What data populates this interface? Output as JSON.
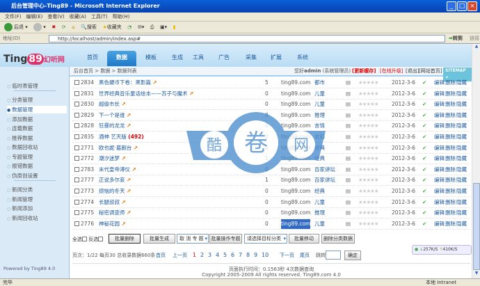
{
  "window": {
    "title": "后台管理中心-Ting89 - Microsoft Internet Explorer"
  },
  "menu": [
    "文件(F)",
    "编辑(E)",
    "查看(V)",
    "收藏(A)",
    "工具(T)",
    "帮助(H)"
  ],
  "toolbar": {
    "back": "后退",
    "search": "搜索",
    "favorites": "收藏夹"
  },
  "address": {
    "label": "地址(D)",
    "url": "http://localhost/admin/index.asp#",
    "go": "转到",
    "links": "链接"
  },
  "logo": {
    "text": "Ting89幻听网.com"
  },
  "tabs": [
    "首页",
    "数据",
    "模板",
    "生成",
    "工具",
    "广告",
    "采集",
    "扩展",
    "系统"
  ],
  "breadcrumb": "后台首页 > 数据 > 数据列表",
  "user": {
    "greeting": "您好",
    "name": "admin",
    "role": "(系统管理员)",
    "refresh": "[更新缓存]",
    "upgrade": "[在线升级]",
    "logout": "[退出]",
    "home": "[网站首页]",
    "sitemap": "SITEMAP +"
  },
  "sidebar": {
    "items": [
      "临时表管理",
      "分类管理",
      "数据管理",
      "添加数据",
      "连载数据",
      "推荐数据",
      "数据回收站",
      "专题管理",
      "报错数据",
      "伪原创设置",
      "新闻分类",
      "新闻管理",
      "新闻添加",
      "新闻回收站"
    ],
    "powered": "Powered by Ting89 4.0"
  },
  "rows": [
    {
      "id": "2834",
      "title": "黑色硬币下卷：黑影篇",
      "count": "5",
      "source": "ting89.com",
      "cat": "都市",
      "date": "2012-3-6"
    },
    {
      "id": "2831",
      "title": "世界经典音乐童话绘本——苏子与魔术",
      "count": "0",
      "source": "ting89.com",
      "cat": "儿童",
      "date": "2012-3-6"
    },
    {
      "id": "2830",
      "title": "超级市长",
      "count": "0",
      "source": "ting89.com",
      "cat": "儿童",
      "date": "2012-3-6"
    },
    {
      "id": "2829",
      "title": "下一个是谁",
      "count": "0",
      "source": "ting89.com",
      "cat": "推理",
      "date": "2012-3-6"
    },
    {
      "id": "2828",
      "title": "狂暴的龙龙",
      "count": "0",
      "source": "ting89.com",
      "cat": "言情",
      "date": "2012-3-6"
    },
    {
      "id": "2835",
      "title": "酒神 艺天版",
      "extra": "(492)",
      "count": "0",
      "source": "ting89.com",
      "cat": "玄幻",
      "date": "2012-3-6"
    },
    {
      "id": "2771",
      "title": "欧也妮·葛朗台",
      "count": "0",
      "source": "ting89.com",
      "cat": "经典",
      "date": "2012-3-6"
    },
    {
      "id": "2772",
      "title": "潮汐迷梦",
      "count": "1",
      "source": "ting89.com",
      "cat": "经典",
      "date": "2012-3-6"
    },
    {
      "id": "2783",
      "title": "末代皇帝溥仪",
      "count": "0",
      "source": "ting89.com",
      "cat": "百家讲坛",
      "date": "2012-3-6"
    },
    {
      "id": "2777",
      "title": "正说多尔衮",
      "count": "1",
      "source": "ting89.com",
      "cat": "百家讲坛",
      "date": "2012-3-6"
    },
    {
      "id": "2773",
      "title": "烦恼的冬天",
      "count": "0",
      "source": "ting89.com",
      "cat": "经典",
      "date": "2012-3-6"
    },
    {
      "id": "2774",
      "title": "长腿叔叔",
      "count": "0",
      "source": "ting89.com",
      "cat": "儿童",
      "date": "2012-3-6"
    },
    {
      "id": "2775",
      "title": "秘密调查师",
      "count": "0",
      "source": "ting89.com",
      "cat": "推理",
      "date": "2012-3-6"
    },
    {
      "id": "2776",
      "title": "神秘花园",
      "count": "0",
      "source": "ting89.com",
      "cat": "儿童",
      "date": "2012-3-6"
    }
  ],
  "row_actions": {
    "edit": "编辑",
    "delete": "删除",
    "hide": "隐藏"
  },
  "batch": {
    "select_all": "全选",
    "invert": "反选",
    "delete": "批量删除",
    "generate": "批量生成",
    "topic_select": "取 消 专 题",
    "topic_op": "批量操作专题",
    "cat_select": "请选择目标分类",
    "move": "批量移动",
    "delete_cat": "删除分类数据"
  },
  "pagination": {
    "info": "页次：1/22 每页30 总收录数据660条",
    "first": "首页",
    "prev": "上一页",
    "pages": [
      "1",
      "2",
      "3",
      "4",
      "5",
      "6",
      "7",
      "8",
      "9",
      "10"
    ],
    "current": "1",
    "next": "下一页",
    "last": "尾页",
    "jump": "跳转",
    "ok": "确定"
  },
  "footer": {
    "exec": "页面执行时间：0.1563秒 4次数据查询",
    "copyright": "Copyright 2005-2009 All rights reserved. Ting89.com 4.0"
  },
  "speed": {
    "down": "257K/S",
    "up": "410K/S"
  },
  "watermark": "酷卷网",
  "status": {
    "left": "完毕",
    "zone": "本地 Intranet"
  }
}
